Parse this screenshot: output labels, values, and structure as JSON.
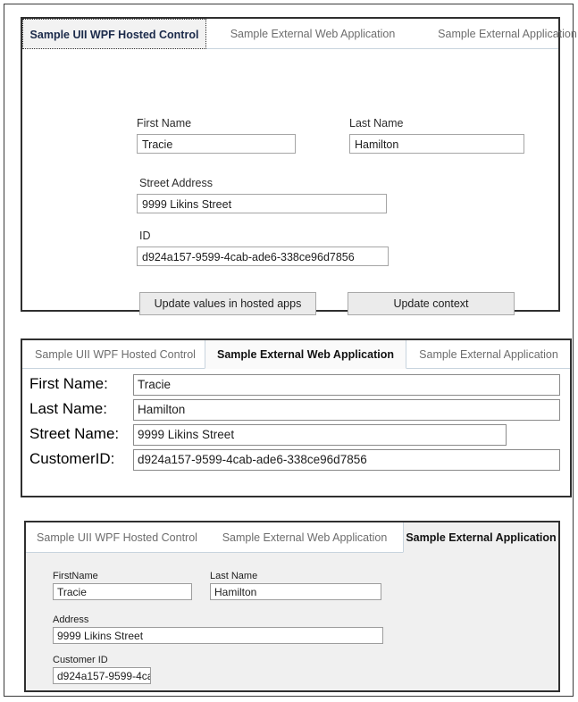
{
  "record": {
    "first_name": "Tracie",
    "last_name": "Hamilton",
    "street": "9999 Likins Street",
    "id": "d924a157-9599-4cab-ade6-338ce96d7856",
    "id_truncated": "d924a157-9599-4ca"
  },
  "colors": {
    "frame_border": "#3a3a3a",
    "panel_border": "#2f2f2f",
    "tab_inactive_text": "#6d6d6d",
    "tab_active_text": "#111111",
    "tab_underline": "#c8d4de",
    "input_border": "#a5a5a5",
    "button_face": "#ebebeb",
    "panel3_background": "#f0f0f0"
  },
  "panel_wpf": {
    "tabs": [
      {
        "label": "Sample UII WPF Hosted Control",
        "active": true
      },
      {
        "label": "Sample External Web Application",
        "active": false
      },
      {
        "label": "Sample External Application",
        "active": false
      }
    ],
    "fields": {
      "first_name_label": "First Name",
      "first_name_value": "Tracie",
      "last_name_label": "Last Name",
      "last_name_value": "Hamilton",
      "street_label": "Street Address",
      "street_value": "9999 Likins Street",
      "id_label": "ID",
      "id_value": "d924a157-9599-4cab-ade6-338ce96d7856"
    },
    "buttons": {
      "update_values": "Update values in hosted apps",
      "update_context": "Update context"
    }
  },
  "panel_web": {
    "tabs": [
      {
        "label": "Sample UII WPF Hosted Control",
        "active": false
      },
      {
        "label": "Sample External Web Application",
        "active": true
      },
      {
        "label": "Sample External Application",
        "active": false
      }
    ],
    "fields": {
      "first_name_label": "First Name:",
      "first_name_value": "Tracie",
      "last_name_label": "Last Name:",
      "last_name_value": "Hamilton",
      "street_label": "Street Name:",
      "street_value": "9999 Likins Street",
      "customer_id_label": "CustomerID:",
      "customer_id_value": "d924a157-9599-4cab-ade6-338ce96d7856"
    }
  },
  "panel_ext": {
    "tabs": [
      {
        "label": "Sample UII WPF Hosted Control",
        "active": false
      },
      {
        "label": "Sample External Web Application",
        "active": false
      },
      {
        "label": "Sample External Application",
        "active": true
      }
    ],
    "fields": {
      "first_name_label": "FirstName",
      "first_name_value": "Tracie",
      "last_name_label": "Last Name",
      "last_name_value": "Hamilton",
      "address_label": "Address",
      "address_value": "9999 Likins Street",
      "customer_id_label": "Customer ID",
      "customer_id_value": "d924a157-9599-4ca"
    }
  }
}
